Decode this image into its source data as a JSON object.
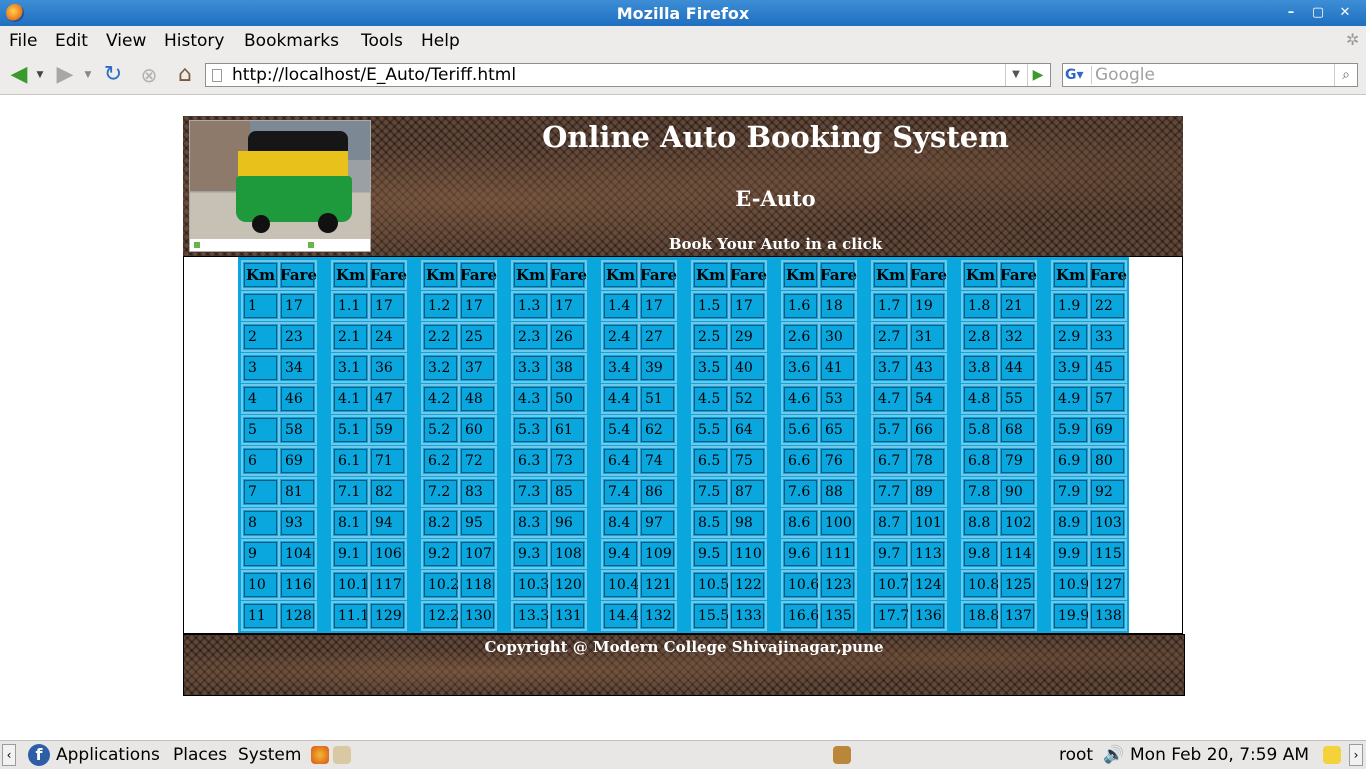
{
  "window": {
    "title": "Mozilla Firefox",
    "minimize": "–",
    "maximize": "▢",
    "close": "✕"
  },
  "menu": {
    "file": "File",
    "edit": "Edit",
    "view": "View",
    "history": "History",
    "bookmarks": "Bookmarks",
    "tools": "Tools",
    "help": "Help"
  },
  "nav": {
    "url": "http://localhost/E_Auto/Teriff.html",
    "search_placeholder": "Google",
    "engine": "G"
  },
  "header": {
    "title": "Online Auto Booking System",
    "subtitle": "E-Auto",
    "tagline": "Book Your Auto in a click"
  },
  "tariff": {
    "headers": {
      "km": "Km",
      "fare": "Fare"
    },
    "columns": [
      {
        "km": [
          "1",
          "2",
          "3",
          "4",
          "5",
          "6",
          "7",
          "8",
          "9",
          "10",
          "11"
        ],
        "fare": [
          "17",
          "23",
          "34",
          "46",
          "58",
          "69",
          "81",
          "93",
          "104",
          "116",
          "128"
        ]
      },
      {
        "km": [
          "1.1",
          "2.1",
          "3.1",
          "4.1",
          "5.1",
          "6.1",
          "7.1",
          "8.1",
          "9.1",
          "10.1",
          "11.1"
        ],
        "fare": [
          "17",
          "24",
          "36",
          "47",
          "59",
          "71",
          "82",
          "94",
          "106",
          "117",
          "129"
        ]
      },
      {
        "km": [
          "1.2",
          "2.2",
          "3.2",
          "4.2",
          "5.2",
          "6.2",
          "7.2",
          "8.2",
          "9.2",
          "10.2",
          "12.2"
        ],
        "fare": [
          "17",
          "25",
          "37",
          "48",
          "60",
          "72",
          "83",
          "95",
          "107",
          "118",
          "130"
        ]
      },
      {
        "km": [
          "1.3",
          "2.3",
          "3.3",
          "4.3",
          "5.3",
          "6.3",
          "7.3",
          "8.3",
          "9.3",
          "10.3",
          "13.3"
        ],
        "fare": [
          "17",
          "26",
          "38",
          "50",
          "61",
          "73",
          "85",
          "96",
          "108",
          "120",
          "131"
        ]
      },
      {
        "km": [
          "1.4",
          "2.4",
          "3.4",
          "4.4",
          "5.4",
          "6.4",
          "7.4",
          "8.4",
          "9.4",
          "10.4",
          "14.4"
        ],
        "fare": [
          "17",
          "27",
          "39",
          "51",
          "62",
          "74",
          "86",
          "97",
          "109",
          "121",
          "132"
        ]
      },
      {
        "km": [
          "1.5",
          "2.5",
          "3.5",
          "4.5",
          "5.5",
          "6.5",
          "7.5",
          "8.5",
          "9.5",
          "10.5",
          "15.5"
        ],
        "fare": [
          "17",
          "29",
          "40",
          "52",
          "64",
          "75",
          "87",
          "98",
          "110",
          "122",
          "133"
        ]
      },
      {
        "km": [
          "1.6",
          "2.6",
          "3.6",
          "4.6",
          "5.6",
          "6.6",
          "7.6",
          "8.6",
          "9.6",
          "10.6",
          "16.6"
        ],
        "fare": [
          "18",
          "30",
          "41",
          "53",
          "65",
          "76",
          "88",
          "100",
          "111",
          "123",
          "135"
        ]
      },
      {
        "km": [
          "1.7",
          "2.7",
          "3.7",
          "4.7",
          "5.7",
          "6.7",
          "7.7",
          "8.7",
          "9.7",
          "10.7",
          "17.7"
        ],
        "fare": [
          "19",
          "31",
          "43",
          "54",
          "66",
          "78",
          "89",
          "101",
          "113",
          "124",
          "136"
        ]
      },
      {
        "km": [
          "1.8",
          "2.8",
          "3.8",
          "4.8",
          "5.8",
          "6.8",
          "7.8",
          "8.8",
          "9.8",
          "10.8",
          "18.8"
        ],
        "fare": [
          "21",
          "32",
          "44",
          "55",
          "68",
          "79",
          "90",
          "102",
          "114",
          "125",
          "137"
        ]
      },
      {
        "km": [
          "1.9",
          "2.9",
          "3.9",
          "4.9",
          "5.9",
          "6.9",
          "7.9",
          "8.9",
          "9.9",
          "10.9",
          "19.9"
        ],
        "fare": [
          "22",
          "33",
          "45",
          "57",
          "69",
          "80",
          "92",
          "103",
          "115",
          "127",
          "138"
        ]
      }
    ]
  },
  "footer": {
    "copyright": "Copyright @ Modern College Shivajinagar,pune"
  },
  "taskbar": {
    "applications": "Applications",
    "places": "Places",
    "system": "System",
    "user": "root",
    "clock": "Mon Feb 20,  7:59 AM"
  }
}
